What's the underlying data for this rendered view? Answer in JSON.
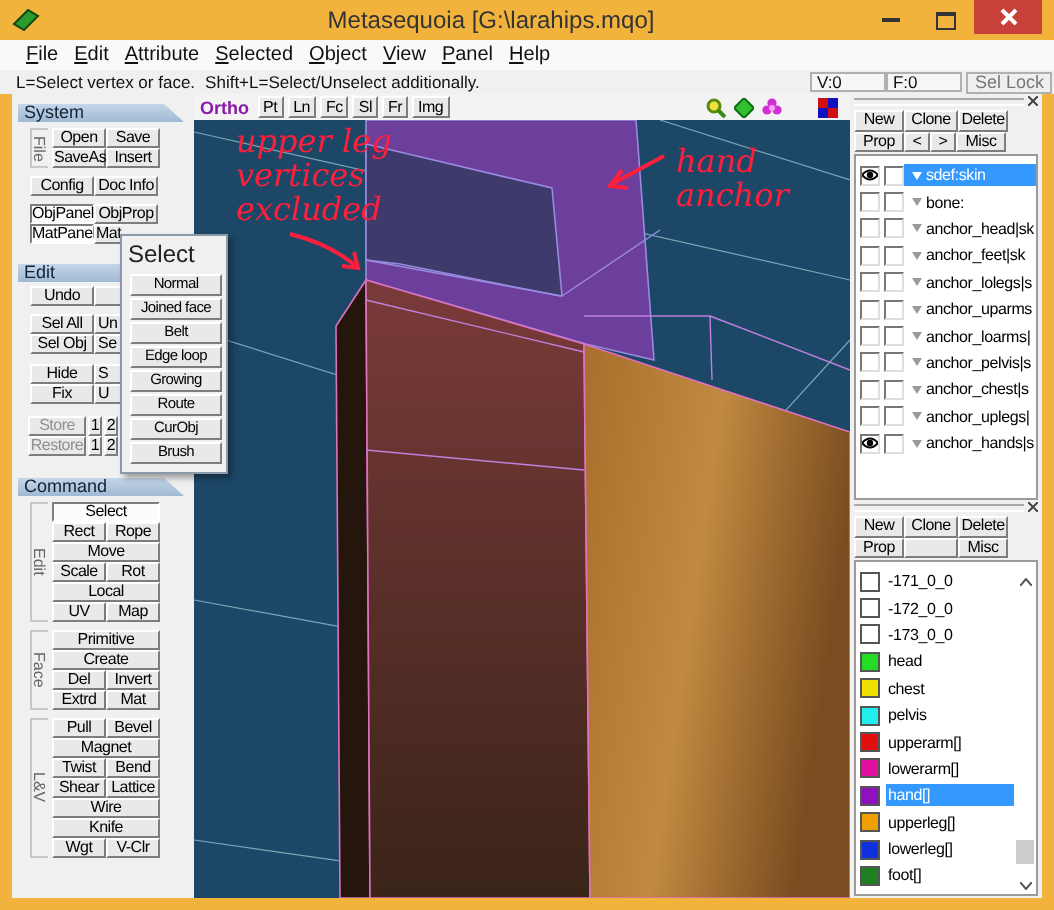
{
  "window": {
    "title": "Metasequoia [G:\\larahips.mqo]"
  },
  "menu": [
    "File",
    "Edit",
    "Attribute",
    "Selected",
    "Object",
    "View",
    "Panel",
    "Help"
  ],
  "hint_bar": {
    "hints": [
      "L=Select vertex or face.",
      "Shift+L=Select/Unselect additionally."
    ],
    "vertex_count": "V:0",
    "face_count": "F:0",
    "sel_lock_button": "Sel Lock"
  },
  "system_panel": {
    "title": "System",
    "file_group": {
      "label": "File",
      "rows": [
        [
          "Open",
          "Save"
        ],
        [
          "SaveAs",
          "Insert"
        ]
      ]
    },
    "doc_row": [
      "Config",
      "Doc Info"
    ],
    "panel_toggles": [
      {
        "label": "ObjPanel",
        "pressed": true
      },
      {
        "label": "ObjProp",
        "pressed": false
      },
      {
        "label": "MatPanel",
        "pressed": true
      },
      {
        "label": "Mat",
        "pressed": false
      }
    ]
  },
  "edit_panel": {
    "title": "Edit",
    "rows": [
      [
        "Undo"
      ],
      [
        "Sel All",
        "Un"
      ],
      [
        "Sel Obj",
        "Se"
      ],
      [
        "Hide",
        "S"
      ],
      [
        "Fix",
        "U"
      ]
    ],
    "store_rows": [
      {
        "label": "Store",
        "disabled": true,
        "slots": [
          "1",
          "2"
        ]
      },
      {
        "label": "Restore",
        "disabled": true,
        "slots": [
          "1",
          "2"
        ]
      }
    ]
  },
  "command_panel": {
    "title": "Command",
    "groups": [
      {
        "label": "Edit",
        "rows": [
          [
            {
              "label": "Select",
              "selected": true
            }
          ],
          [
            {
              "label": "Rect",
              "selected": false
            },
            {
              "label": "Rope",
              "selected": false
            }
          ],
          [
            {
              "label": "Move",
              "selected": false
            }
          ],
          [
            {
              "label": "Scale",
              "selected": false
            },
            {
              "label": "Rot",
              "selected": false
            }
          ],
          [
            {
              "label": "Local",
              "selected": false
            }
          ],
          [
            {
              "label": "UV",
              "selected": false
            },
            {
              "label": "Map",
              "selected": false
            }
          ]
        ]
      },
      {
        "label": "Face",
        "rows": [
          [
            {
              "label": "Primitive",
              "selected": false
            }
          ],
          [
            {
              "label": "Create",
              "selected": false
            }
          ],
          [
            {
              "label": "Del",
              "selected": false
            },
            {
              "label": "Invert",
              "selected": false
            }
          ],
          [
            {
              "label": "Extrd",
              "selected": false
            },
            {
              "label": "Mat",
              "selected": false
            }
          ]
        ]
      },
      {
        "label": "L&V",
        "rows": [
          [
            {
              "label": "Pull",
              "selected": false
            },
            {
              "label": "Bevel",
              "selected": false
            }
          ],
          [
            {
              "label": "Magnet",
              "selected": false
            }
          ],
          [
            {
              "label": "Twist",
              "selected": false
            },
            {
              "label": "Bend",
              "selected": false
            }
          ],
          [
            {
              "label": "Shear",
              "selected": false
            },
            {
              "label": "Lattice",
              "selected": false
            }
          ],
          [
            {
              "label": "Wire",
              "selected": false
            }
          ],
          [
            {
              "label": "Knife",
              "selected": false
            }
          ],
          [
            {
              "label": "Wgt",
              "selected": false
            },
            {
              "label": "V-Clr",
              "selected": false
            }
          ]
        ]
      }
    ]
  },
  "select_popup": {
    "title": "Select",
    "options": [
      "Normal",
      "Joined face",
      "Belt",
      "Edge loop",
      "Growing",
      "Route",
      "CurObj",
      "Brush"
    ]
  },
  "viewport": {
    "projection": "Ortho",
    "view_buttons": [
      "Pt",
      "Ln",
      "Fc",
      "Sl",
      "Fr",
      "Img"
    ],
    "annotations": [
      "upper leg vertices excluded",
      "hand anchor"
    ]
  },
  "object_panel": {
    "buttons": [
      [
        "New",
        "Clone",
        "Delete"
      ],
      [
        "Prop",
        "<",
        ">",
        "Misc"
      ]
    ],
    "objects": [
      {
        "name": "sdef:skin",
        "visible": true,
        "locked": false,
        "selected": true
      },
      {
        "name": "bone:",
        "visible": false,
        "locked": false,
        "selected": false
      },
      {
        "name": "anchor_head|sk",
        "visible": false,
        "locked": false,
        "selected": false
      },
      {
        "name": "anchor_feet|sk",
        "visible": false,
        "locked": false,
        "selected": false
      },
      {
        "name": "anchor_lolegs|s",
        "visible": false,
        "locked": false,
        "selected": false
      },
      {
        "name": "anchor_uparms",
        "visible": false,
        "locked": false,
        "selected": false
      },
      {
        "name": "anchor_loarms|",
        "visible": false,
        "locked": false,
        "selected": false
      },
      {
        "name": "anchor_pelvis|s",
        "visible": false,
        "locked": false,
        "selected": false
      },
      {
        "name": "anchor_chest|s",
        "visible": false,
        "locked": false,
        "selected": false
      },
      {
        "name": "anchor_uplegs|",
        "visible": false,
        "locked": false,
        "selected": false
      },
      {
        "name": "anchor_hands|s",
        "visible": true,
        "locked": false,
        "selected": false
      }
    ]
  },
  "material_panel": {
    "buttons": [
      [
        "New",
        "Clone",
        "Delete"
      ],
      [
        "Prop",
        "Misc"
      ]
    ],
    "materials": [
      {
        "name": "-171_0_0",
        "color": "#ffffff",
        "selected": false
      },
      {
        "name": "-172_0_0",
        "color": "#ffffff",
        "selected": false
      },
      {
        "name": "-173_0_0",
        "color": "#ffffff",
        "selected": false
      },
      {
        "name": "head",
        "color": "#22dd22",
        "selected": false
      },
      {
        "name": "chest",
        "color": "#f0e000",
        "selected": false
      },
      {
        "name": "pelvis",
        "color": "#22eeee",
        "selected": false
      },
      {
        "name": "upperarm[]",
        "color": "#e01010",
        "selected": false
      },
      {
        "name": "lowerarm[]",
        "color": "#e010a0",
        "selected": false
      },
      {
        "name": "hand[]",
        "color": "#9010c0",
        "selected": true
      },
      {
        "name": "upperleg[]",
        "color": "#f0a000",
        "selected": false
      },
      {
        "name": "lowerleg[]",
        "color": "#1030e0",
        "selected": false
      },
      {
        "name": "foot[]",
        "color": "#208020",
        "selected": false
      }
    ]
  }
}
